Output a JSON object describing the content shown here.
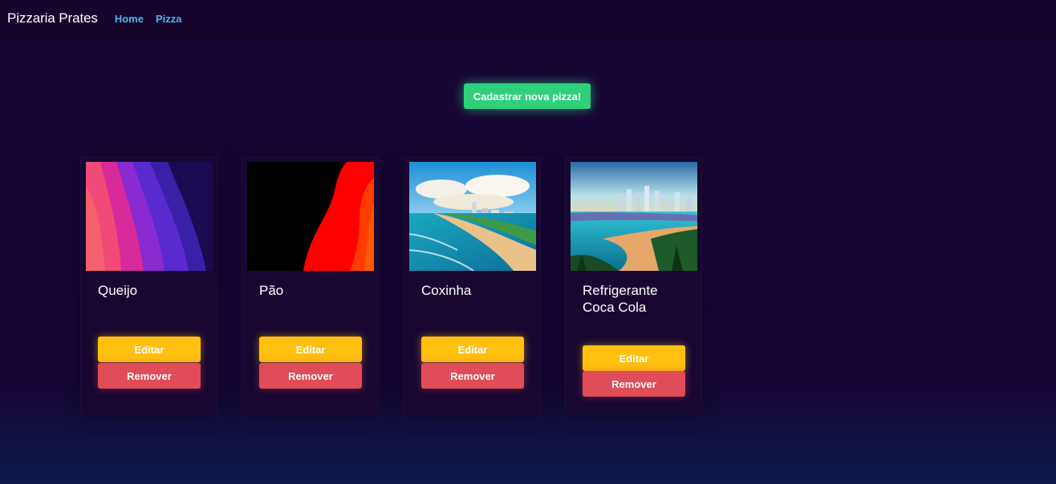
{
  "navbar": {
    "brand": "Pizzaria Prates",
    "links": [
      "Home",
      "Pizza"
    ]
  },
  "main": {
    "create_button": "Cadastrar nova pizza!"
  },
  "products": [
    {
      "name": "Queijo",
      "image": "abstract-waves-pink-purple",
      "edit_label": "Editar",
      "remove_label": "Remover"
    },
    {
      "name": "Pão",
      "image": "abstract-red-black",
      "edit_label": "Editar",
      "remove_label": "Remover"
    },
    {
      "name": "Coxinha",
      "image": "beach-city-photo",
      "edit_label": "Editar",
      "remove_label": "Remover"
    },
    {
      "name": "Refrigerante Coca Cola",
      "image": "beach-city-sunset-photo",
      "edit_label": "Editar",
      "remove_label": "Remover"
    }
  ],
  "colors": {
    "nav_link": "#4fb3e6",
    "create_button": "#2fd07b",
    "edit_button": "#ffc010",
    "remove_button": "#e04c58",
    "background": "#170634"
  }
}
